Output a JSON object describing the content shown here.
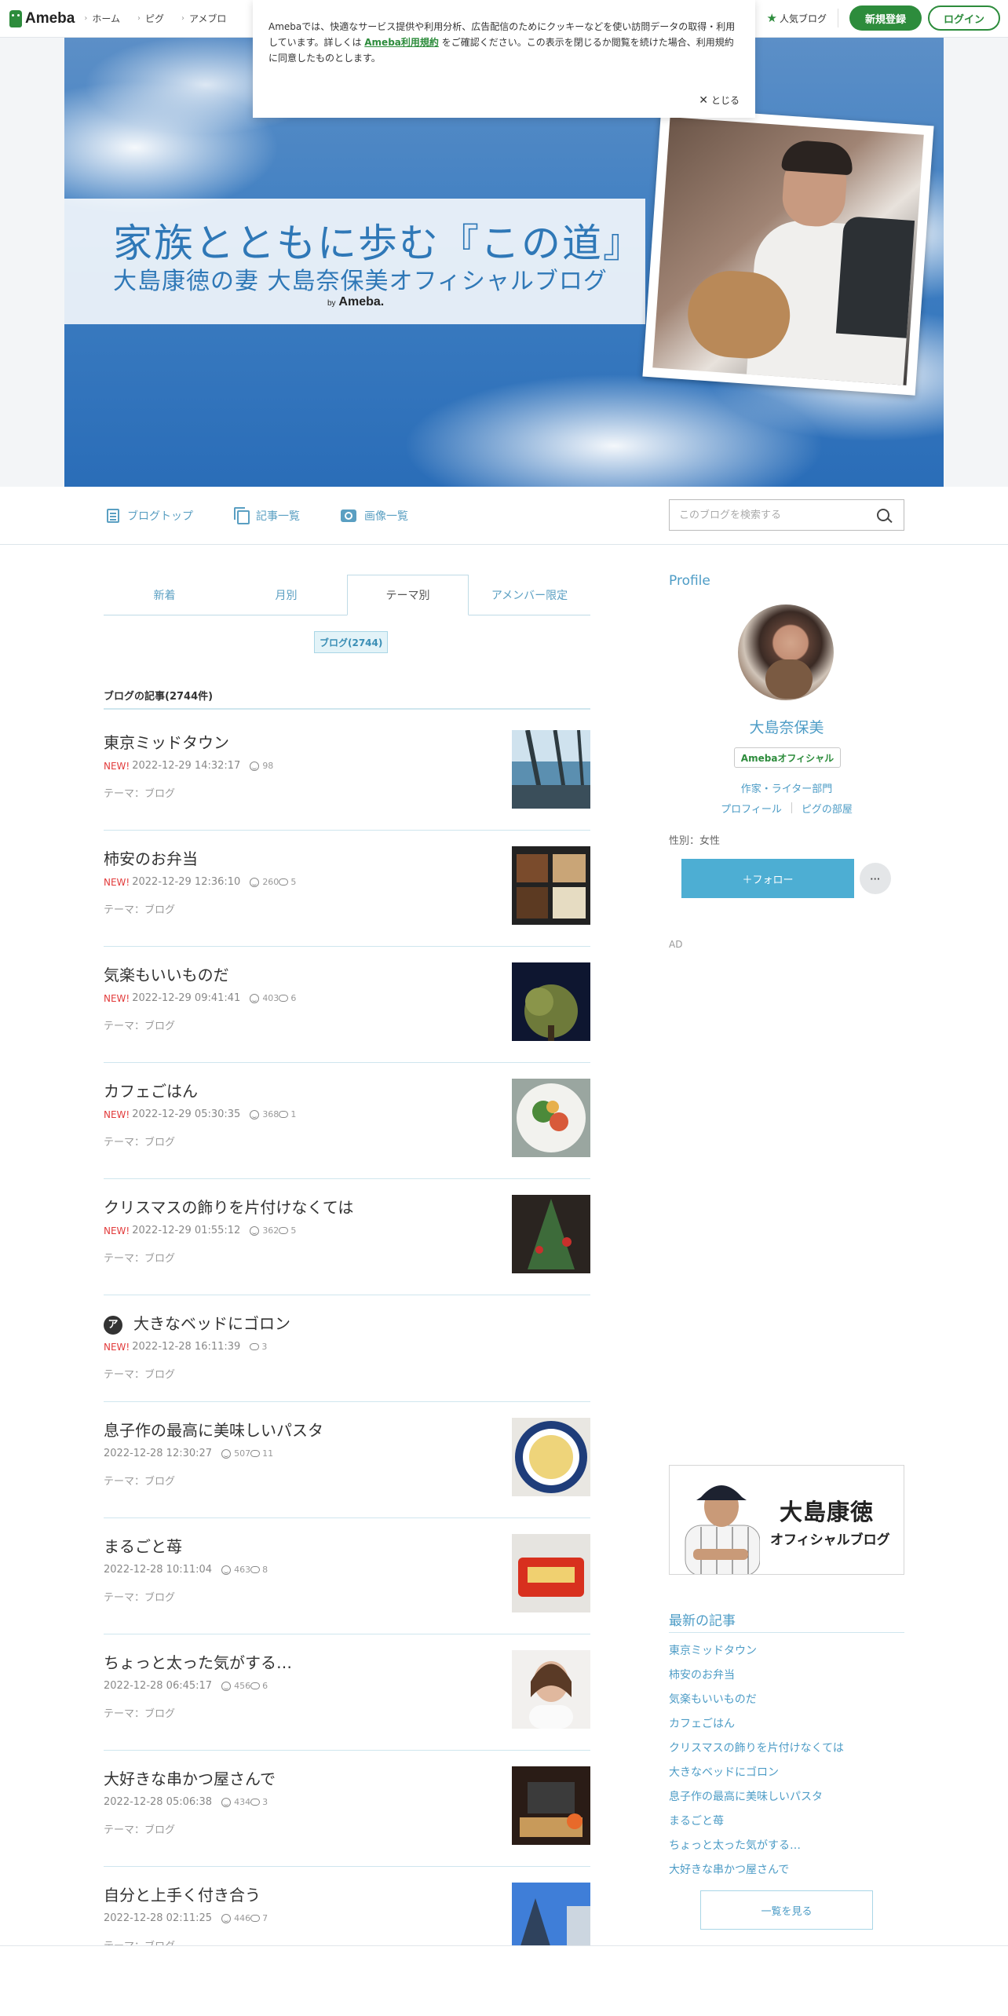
{
  "topbar": {
    "brand": "Ameba",
    "nav": [
      "ホーム",
      "ピグ",
      "アメブロ"
    ],
    "popular": "人気ブログ",
    "register": "新規登録",
    "login": "ログイン"
  },
  "cookie": {
    "text_before": "Amebaでは、快適なサービス提供や利用分析、広告配信のためにクッキーなどを使い訪問データの取得・利用しています。詳しくは ",
    "link": "Ameba利用規約",
    "text_after": " をご確認ください。この表示を閉じるか閲覧を続けた場合、利用規約に同意したものとします。",
    "close": "とじる"
  },
  "banner": {
    "title": "家族とともに歩む『この道』",
    "subtitle": "大島康徳の妻 大島奈保美オフィシャルブログ",
    "by_small": "by",
    "by_brand": "Ameba."
  },
  "subnav": {
    "items": [
      "ブログトップ",
      "記事一覧",
      "画像一覧"
    ],
    "search_placeholder": "このブログを検索する"
  },
  "tabs": [
    "新着",
    "月別",
    "テーマ別",
    "アメンバー限定"
  ],
  "theme_chip": "ブログ(2744)",
  "list_heading": "ブログの記事(2744件)",
  "new_label": "NEW!",
  "theme_label": "テーマ：ブログ",
  "posts": [
    {
      "title": "東京ミッドタウン",
      "new": true,
      "date": "2022-12-29 14:32:17",
      "likes": "98",
      "comments": ""
    },
    {
      "title": "柿安のお弁当",
      "new": true,
      "date": "2022-12-29 12:36:10",
      "likes": "260",
      "comments": "5"
    },
    {
      "title": "気楽もいいものだ",
      "new": true,
      "date": "2022-12-29 09:41:41",
      "likes": "403",
      "comments": "6"
    },
    {
      "title": "カフェごはん",
      "new": true,
      "date": "2022-12-29 05:30:35",
      "likes": "368",
      "comments": "1"
    },
    {
      "title": "クリスマスの飾りを片付けなくては",
      "new": true,
      "date": "2022-12-29 01:55:12",
      "likes": "362",
      "comments": "5"
    },
    {
      "title": "大きなベッドにゴロン",
      "new": true,
      "date": "2022-12-28 16:11:39",
      "likes": "",
      "comments": "3",
      "badge": "ア"
    },
    {
      "title": "息子作の最高に美味しいパスタ",
      "new": false,
      "date": "2022-12-28 12:30:27",
      "likes": "507",
      "comments": "11"
    },
    {
      "title": "まるごと苺",
      "new": false,
      "date": "2022-12-28 10:11:04",
      "likes": "463",
      "comments": "8"
    },
    {
      "title": "ちょっと太った気がする…",
      "new": false,
      "date": "2022-12-28 06:45:17",
      "likes": "456",
      "comments": "6"
    },
    {
      "title": "大好きな串かつ屋さんで",
      "new": false,
      "date": "2022-12-28 05:06:38",
      "likes": "434",
      "comments": "3"
    },
    {
      "title": "自分と上手く付き合う",
      "new": false,
      "date": "2022-12-28 02:11:25",
      "likes": "446",
      "comments": "7"
    }
  ],
  "sidebar": {
    "profile_heading": "Profile",
    "name": "大島奈保美",
    "badge": "Amebaオフィシャル",
    "genre": "作家・ライター部門",
    "links": [
      "プロフィール",
      "ピグの部屋"
    ],
    "gender": "性別：女性",
    "follow": "＋フォロー",
    "more": "···",
    "ad": "AD",
    "husband_banner": {
      "name": "大島康徳",
      "sub": "オフィシャルブログ"
    },
    "latest_heading": "最新の記事",
    "latest": [
      "東京ミッドタウン",
      "柿安のお弁当",
      "気楽もいいものだ",
      "カフェごはん",
      "クリスマスの飾りを片付けなくては",
      "大きなベッドにゴロン",
      "息子作の最高に美味しいパスタ",
      "まるごと苺",
      "ちょっと太った気がする…",
      "大好きな串かつ屋さんで"
    ],
    "view_all": "一覧を見る"
  }
}
